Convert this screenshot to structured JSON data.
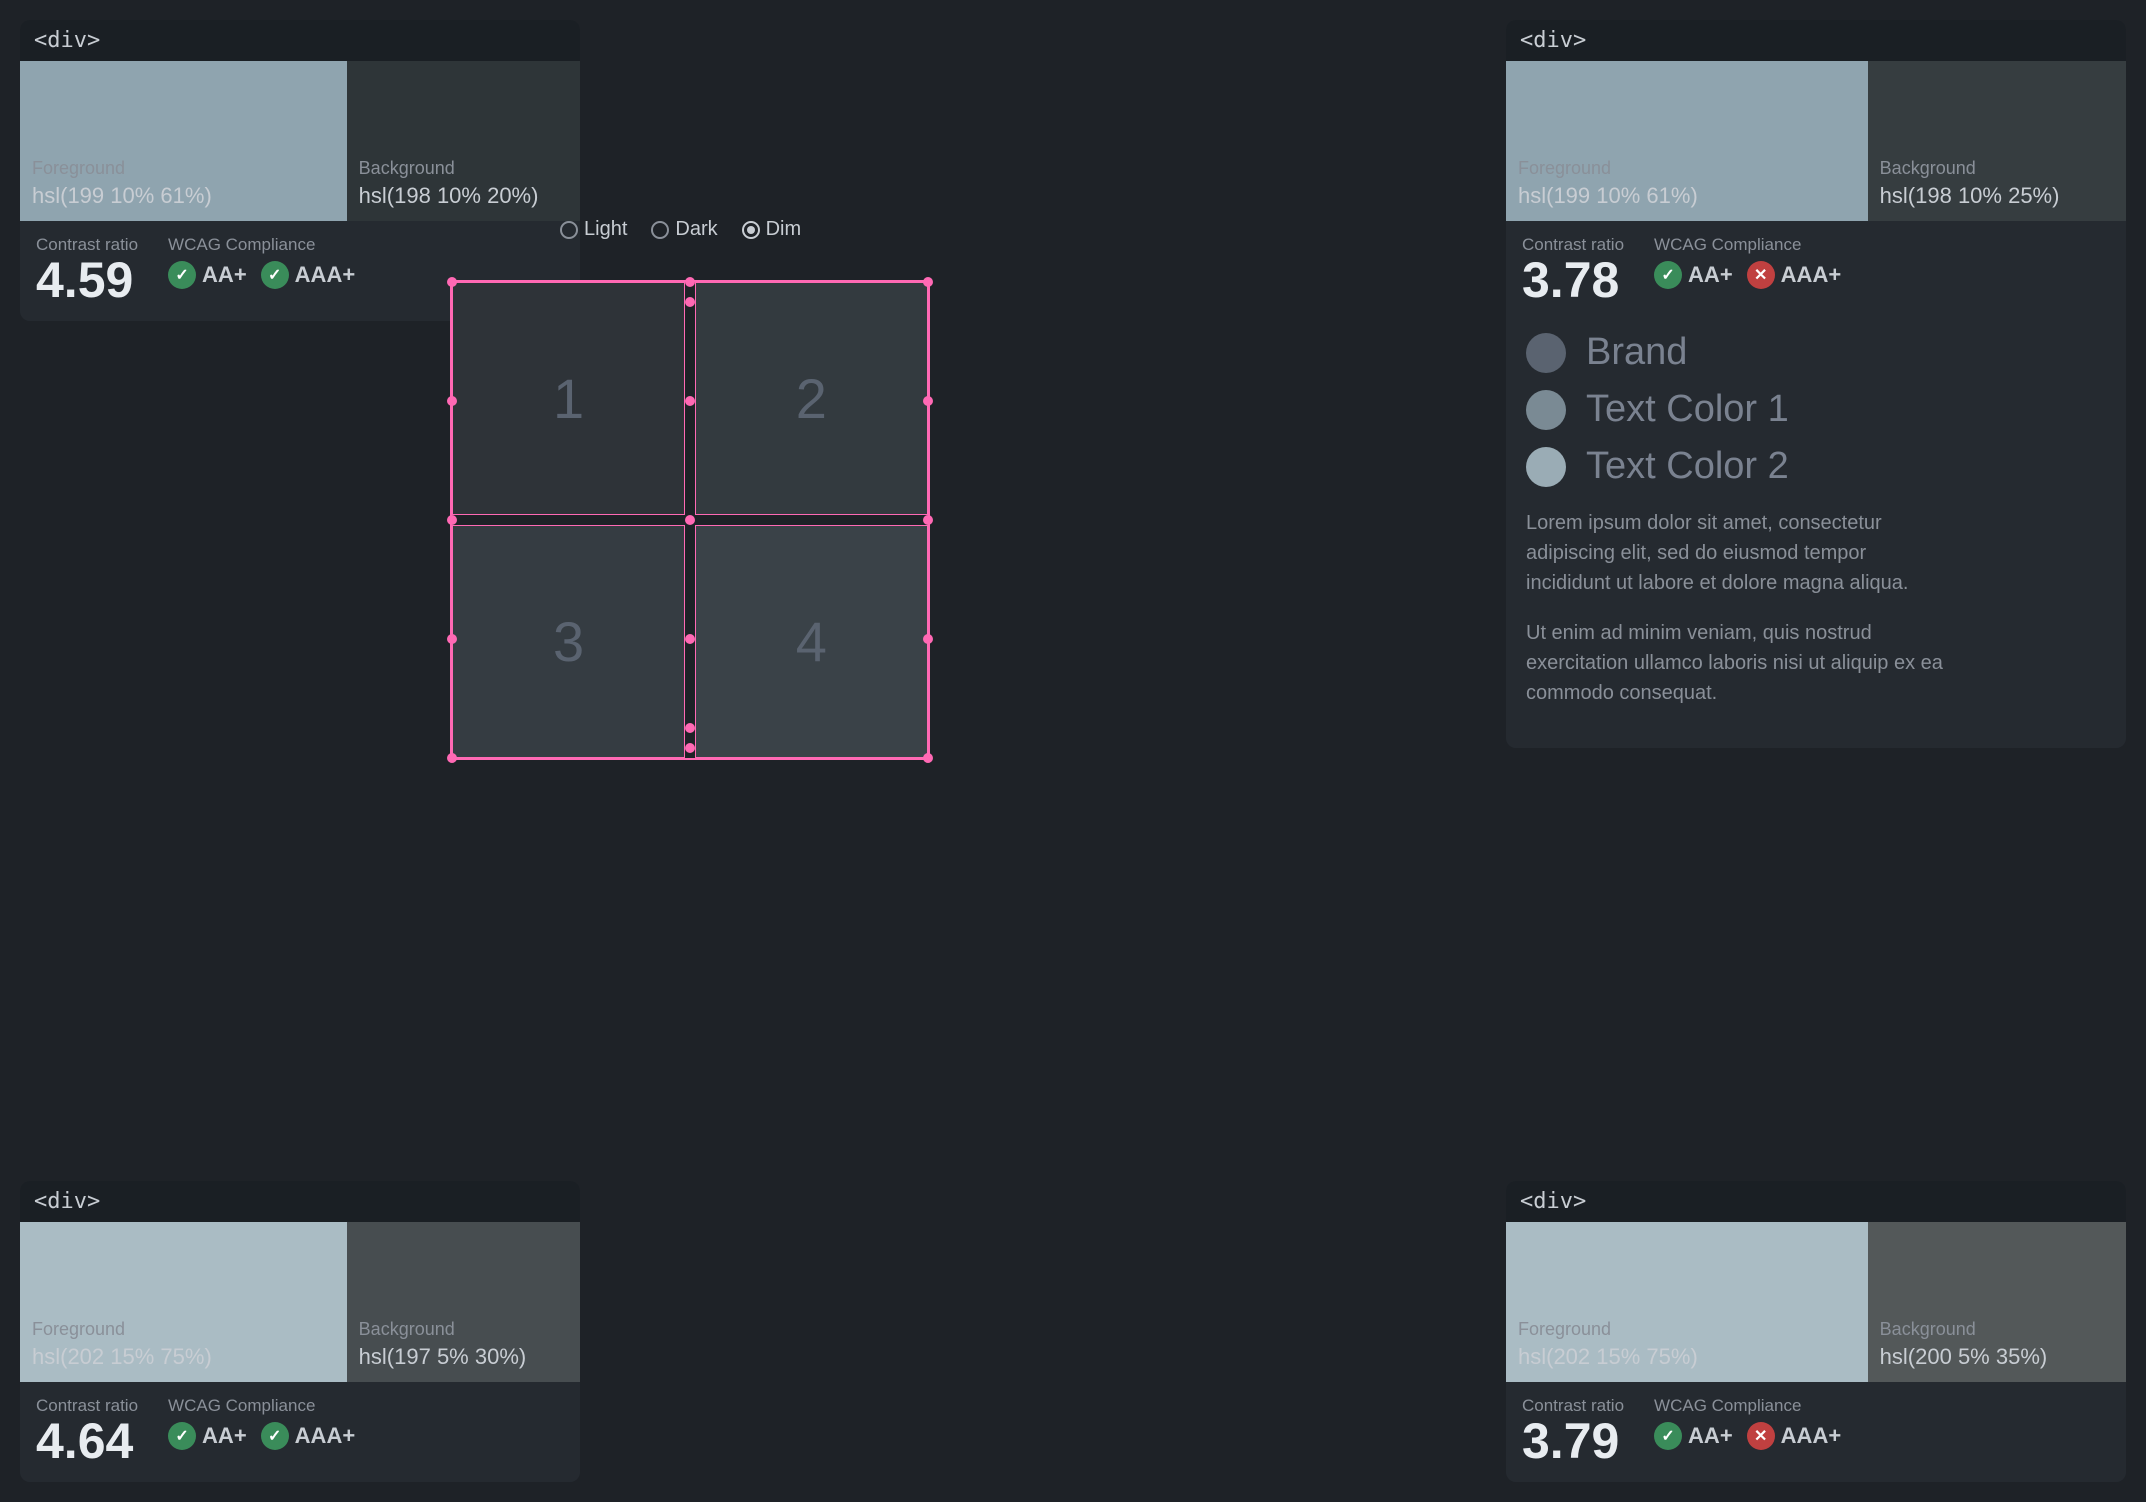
{
  "panels": {
    "top_left": {
      "tag": "<div>",
      "foreground": {
        "label": "Foreground",
        "value": "hsl(199 10% 61%)",
        "color": "#8fa4af"
      },
      "background": {
        "label": "Background",
        "value": "hsl(198 10% 20%)",
        "color": "#2e3538"
      },
      "contrast_label": "Contrast ratio",
      "contrast_value": "4.59",
      "wcag_label": "WCAG Compliance",
      "wcag_aa": {
        "label": "AA+",
        "pass": true
      },
      "wcag_aaa": {
        "label": "AAA+",
        "pass": true
      }
    },
    "top_right": {
      "tag": "<div>",
      "foreground": {
        "label": "Foreground",
        "value": "hsl(199 10% 61%)",
        "color": "#8fa4af"
      },
      "background": {
        "label": "Background",
        "value": "hsl(198 10% 25%)",
        "color": "#363d40"
      },
      "contrast_label": "Contrast ratio",
      "contrast_value": "3.78",
      "wcag_label": "WCAG Compliance",
      "wcag_aa": {
        "label": "AA+",
        "pass": true
      },
      "wcag_aaa": {
        "label": "AAA+",
        "pass": false
      }
    },
    "bottom_left": {
      "tag": "<div>",
      "foreground": {
        "label": "Foreground",
        "value": "hsl(202 15% 75%)",
        "color": "#aabcc4"
      },
      "background": {
        "label": "Background",
        "value": "hsl(197 5% 30%)",
        "color": "#474d50"
      },
      "contrast_label": "Contrast ratio",
      "contrast_value": "4.64",
      "wcag_label": "WCAG Compliance",
      "wcag_aa": {
        "label": "AA+",
        "pass": true
      },
      "wcag_aaa": {
        "label": "AAA+",
        "pass": true
      }
    },
    "bottom_right": {
      "tag": "<div>",
      "foreground": {
        "label": "Foreground",
        "value": "hsl(202 15% 75%)",
        "color": "#aabcc4"
      },
      "background": {
        "label": "Background",
        "value": "hsl(200 5% 35%)",
        "color": "#535859"
      },
      "contrast_label": "Contrast ratio",
      "contrast_value": "3.79",
      "wcag_label": "WCAG Compliance",
      "wcag_aa": {
        "label": "AA+",
        "pass": true
      },
      "wcag_aaa": {
        "label": "AAA+",
        "pass": false
      }
    }
  },
  "theme_options": [
    {
      "label": "Light",
      "selected": false
    },
    {
      "label": "Dark",
      "selected": false
    },
    {
      "label": "Dim",
      "selected": true
    }
  ],
  "grid": {
    "cells": [
      "1",
      "2",
      "3",
      "4"
    ]
  },
  "legend": {
    "items": [
      {
        "label": "Brand",
        "color": "#5a6370"
      },
      {
        "label": "Text Color 1",
        "color": "#7a8a94"
      },
      {
        "label": "Text Color 2",
        "color": "#9aacb5"
      }
    ]
  },
  "lorem": {
    "paragraph1": "Lorem ipsum dolor sit amet, consectetur adipiscing elit, sed do eiusmod tempor incididunt ut labore et dolore magna aliqua.",
    "paragraph2": "Ut enim ad minim veniam, quis nostrud exercitation ullamco laboris nisi ut aliquip ex ea commodo consequat."
  }
}
